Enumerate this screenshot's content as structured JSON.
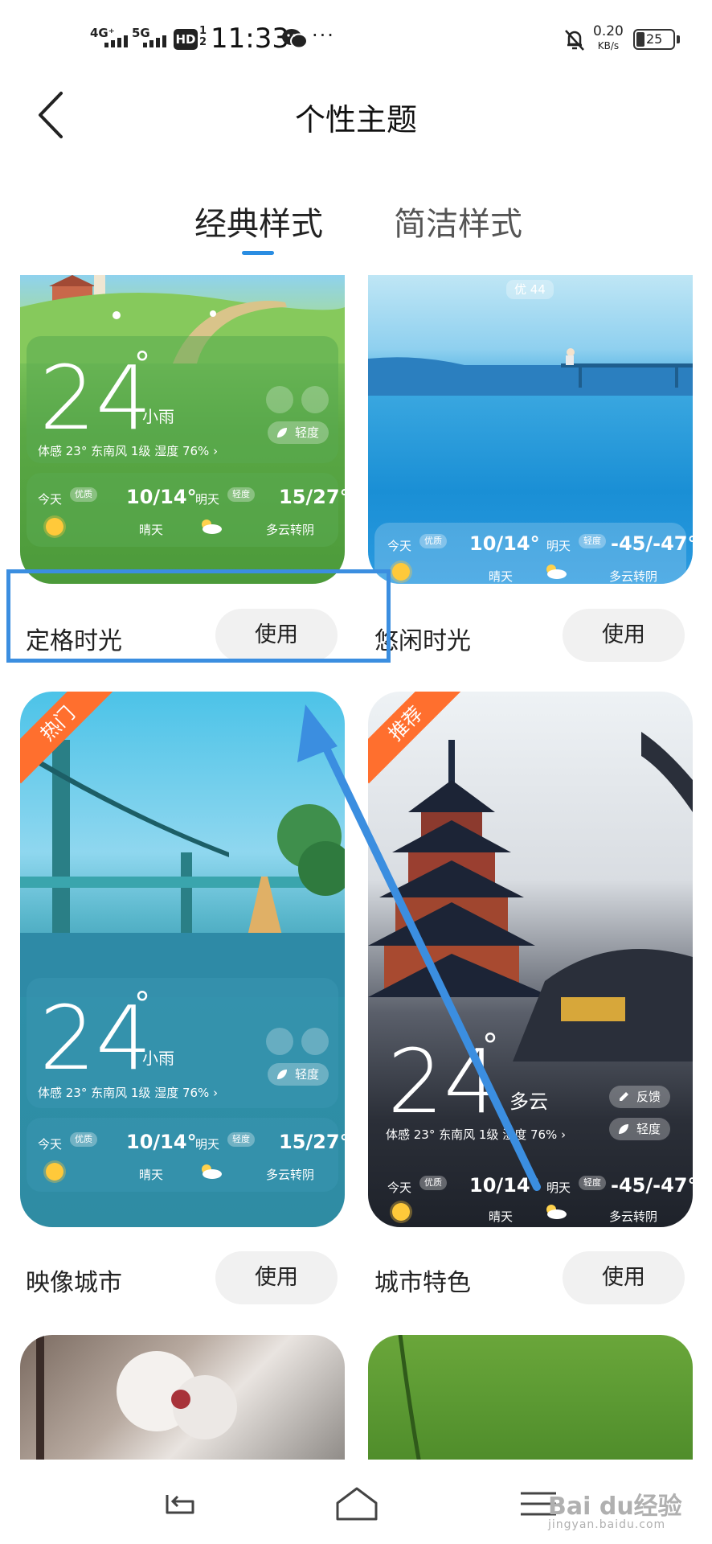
{
  "status_bar": {
    "network1": "4G⁺",
    "network2": "5G",
    "hd": "HD",
    "hd_sub": "1\n2",
    "time": "11:33",
    "more": "···",
    "speed_value": "0.20",
    "speed_unit": "KB/s",
    "battery": "25"
  },
  "header": {
    "title": "个性主题"
  },
  "tabs": [
    {
      "label": "经典样式",
      "active": true
    },
    {
      "label": "简洁样式",
      "active": false
    }
  ],
  "accent_color": "#2a8de2",
  "themes": [
    {
      "name": "定格时光",
      "use_label": "使用",
      "weather": {
        "temp": "24",
        "deg": "°",
        "cond": "小雨",
        "detail": "体感 23°  东南风 1级   湿度 76%  ›",
        "aqi": "轻度",
        "today_label": "今天",
        "today_aq": "优质",
        "today_range": "10/14°",
        "today_cond": "晴天",
        "tomorrow_label": "明天",
        "tomorrow_aq": "轻度",
        "tomorrow_range": "15/27°",
        "tomorrow_cond": "多云转阴"
      }
    },
    {
      "name": "悠闲时光",
      "use_label": "使用",
      "weather": {
        "badge": "优 44",
        "today_label": "今天",
        "today_aq": "优质",
        "today_range": "10/14°",
        "today_cond": "晴天",
        "tomorrow_label": "明天",
        "tomorrow_aq": "轻度",
        "tomorrow_range": "-45/-47°",
        "tomorrow_cond": "多云转阴"
      }
    },
    {
      "name": "映像城市",
      "use_label": "使用",
      "tag": "热门",
      "weather": {
        "temp": "24",
        "deg": "°",
        "cond": "小雨",
        "detail": "体感 23°  东南风 1级   湿度 76%  ›",
        "aqi": "轻度",
        "today_label": "今天",
        "today_aq": "优质",
        "today_range": "10/14°",
        "today_cond": "晴天",
        "tomorrow_label": "明天",
        "tomorrow_aq": "轻度",
        "tomorrow_range": "15/27°",
        "tomorrow_cond": "多云转阴"
      }
    },
    {
      "name": "城市特色",
      "use_label": "使用",
      "tag": "推荐",
      "weather": {
        "temp": "24",
        "deg": "°",
        "cond": "多云",
        "detail": "体感 23°  东南风 1级   湿度 76%  ›",
        "aqi": "轻度",
        "feedback": "反馈",
        "today_label": "今天",
        "today_aq": "优质",
        "today_range": "10/14°",
        "today_cond": "晴天",
        "tomorrow_label": "明天",
        "tomorrow_aq": "轻度",
        "tomorrow_range": "-45/-47°",
        "tomorrow_cond": "多云转阴"
      }
    }
  ],
  "watermark": {
    "brand": "Bai du经验",
    "url": "jingyan.baidu.com"
  }
}
